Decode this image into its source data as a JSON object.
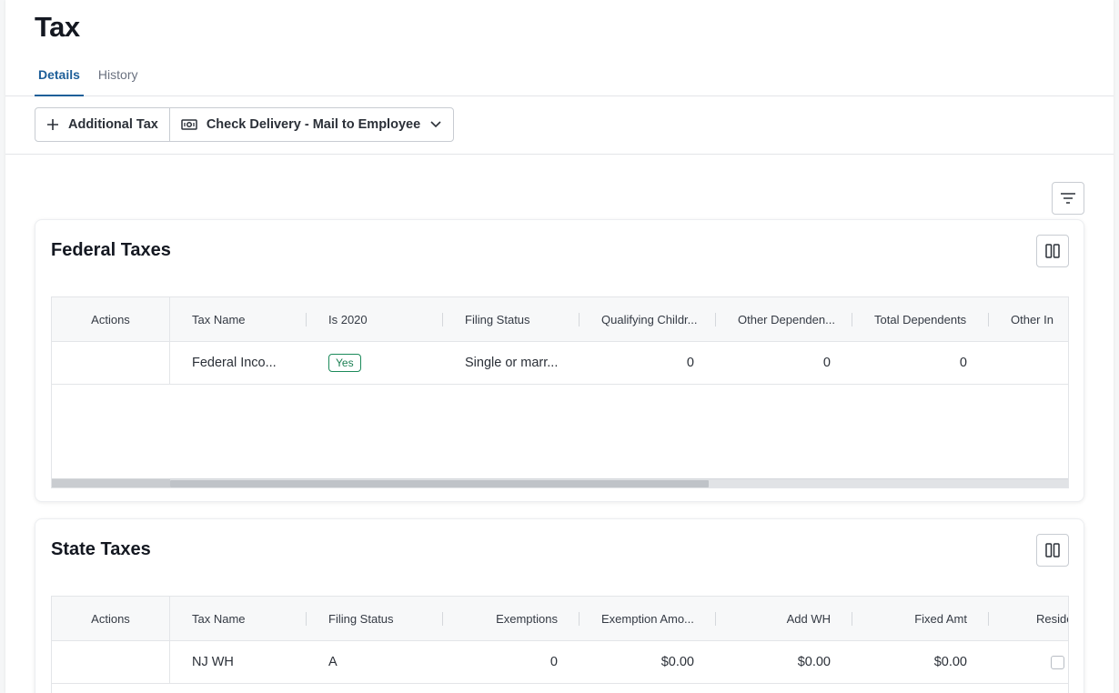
{
  "page": {
    "title": "Tax"
  },
  "tabs": [
    {
      "label": "Details",
      "active": true
    },
    {
      "label": "History",
      "active": false
    }
  ],
  "toolbar": {
    "additional_tax_label": "Additional Tax",
    "check_delivery_label": "Check Delivery - Mail to Employee"
  },
  "icons": {
    "add": "plus-icon",
    "delivery": "money-icon",
    "dropdown": "chevron-down-icon",
    "filter": "filter-icon",
    "columns": "columns-icon"
  },
  "colors": {
    "accent": "#1e5f99",
    "badge_green": "#1b7f52"
  },
  "federal": {
    "title": "Federal Taxes",
    "columns": [
      "Actions",
      "Tax Name",
      "Is 2020",
      "Filing Status",
      "Qualifying Childr...",
      "Other Dependen...",
      "Total Dependents",
      "Other In"
    ],
    "rows": [
      {
        "tax_name": "Federal Inco...",
        "is_2020": "Yes",
        "filing_status": "Single or marr...",
        "qualifying_children": "0",
        "other_dependents": "0",
        "total_dependents": "0"
      }
    ]
  },
  "state": {
    "title": "State Taxes",
    "columns": [
      "Actions",
      "Tax Name",
      "Filing Status",
      "Exemptions",
      "Exemption Amo...",
      "Add WH",
      "Fixed Amt",
      "Reside"
    ],
    "rows": [
      {
        "tax_name": "NJ WH",
        "filing_status": "A",
        "exemptions": "0",
        "exemption_amount": "$0.00",
        "add_wh": "$0.00",
        "fixed_amt": "$0.00",
        "resident": false
      }
    ]
  }
}
